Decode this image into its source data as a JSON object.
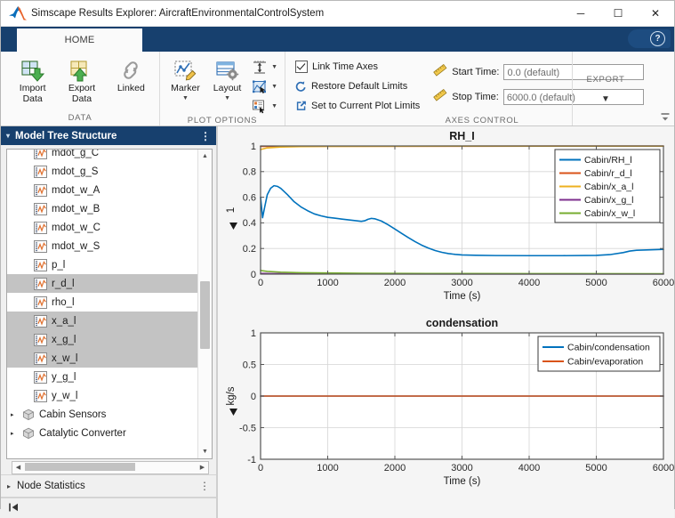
{
  "window": {
    "title": "Simscape Results Explorer: AircraftEnvironmentalControlSystem",
    "app_icon": "matlab-icon",
    "minimize": "─",
    "maximize": "☐",
    "close": "✕"
  },
  "tabs": [
    {
      "label": "HOME",
      "active": true
    }
  ],
  "help": {
    "label": "?"
  },
  "ribbon": {
    "groups": [
      {
        "name": "DATA",
        "label": "DATA",
        "buttons": [
          {
            "label_line1": "Import",
            "label_line2": "Data",
            "icon": "import-data-icon"
          },
          {
            "label_line1": "Export",
            "label_line2": "Data",
            "icon": "export-data-icon"
          },
          {
            "label_line1": "Linked",
            "label_line2": "",
            "icon": "link-icon"
          }
        ]
      },
      {
        "name": "PLOT OPTIONS",
        "label": "PLOT OPTIONS",
        "buttons": [
          {
            "label_line1": "Marker",
            "label_line2": "",
            "icon": "marker-icon",
            "caret": "▼"
          },
          {
            "label_line1": "Layout",
            "label_line2": "",
            "icon": "layout-icon",
            "caret": "▼"
          }
        ],
        "mini": [
          {
            "icon": "axes-limits-icon",
            "caret": "▼"
          },
          {
            "icon": "zoom-region-icon",
            "caret": "▼"
          },
          {
            "icon": "legend-icon",
            "caret": "▼"
          }
        ]
      },
      {
        "name": "AXES CONTROL",
        "label": "AXES CONTROL",
        "checks": [
          {
            "label": "Link Time Axes",
            "checked": true,
            "icon": "checkbox-icon"
          },
          {
            "label": "Restore Default Limits",
            "checked": false,
            "icon": "restore-icon"
          },
          {
            "label": "Set to Current Plot Limits",
            "checked": false,
            "icon": "set-limits-icon"
          }
        ],
        "times": [
          {
            "label": "Start Time:",
            "value": "0.0 (default)",
            "icon": "ruler-icon"
          },
          {
            "label": "Stop Time:",
            "value": "6000.0 (default)",
            "icon": "ruler-icon"
          }
        ]
      },
      {
        "name": "EXPORT",
        "label": "EXPORT",
        "caret": "▼"
      }
    ],
    "collapse_icon": "collapse-ribbon-icon"
  },
  "left_panel": {
    "tree_header": {
      "title": "Model Tree Structure",
      "twisty": "▾",
      "menu": "⋮"
    },
    "stats_header": {
      "title": "Node Statistics",
      "twisty": "▸",
      "menu": "⋮"
    },
    "tree_items": [
      {
        "label": "mdot_g_C",
        "icon": "signal-icon",
        "selected": false,
        "type": "signal",
        "clipped": true
      },
      {
        "label": "mdot_g_S",
        "icon": "signal-icon",
        "selected": false,
        "type": "signal"
      },
      {
        "label": "mdot_w_A",
        "icon": "signal-icon",
        "selected": false,
        "type": "signal"
      },
      {
        "label": "mdot_w_B",
        "icon": "signal-icon",
        "selected": false,
        "type": "signal"
      },
      {
        "label": "mdot_w_C",
        "icon": "signal-icon",
        "selected": false,
        "type": "signal"
      },
      {
        "label": "mdot_w_S",
        "icon": "signal-icon",
        "selected": false,
        "type": "signal"
      },
      {
        "label": "p_l",
        "icon": "signal-icon",
        "selected": false,
        "type": "signal"
      },
      {
        "label": "r_d_l",
        "icon": "signal-icon",
        "selected": true,
        "type": "signal"
      },
      {
        "label": "rho_l",
        "icon": "signal-icon",
        "selected": false,
        "type": "signal"
      },
      {
        "label": "x_a_l",
        "icon": "signal-icon",
        "selected": true,
        "type": "signal"
      },
      {
        "label": "x_g_l",
        "icon": "signal-icon",
        "selected": true,
        "type": "signal"
      },
      {
        "label": "x_w_l",
        "icon": "signal-icon",
        "selected": true,
        "type": "signal"
      },
      {
        "label": "y_g_l",
        "icon": "signal-icon",
        "selected": false,
        "type": "signal"
      },
      {
        "label": "y_w_l",
        "icon": "signal-icon",
        "selected": false,
        "type": "signal"
      },
      {
        "label": "Cabin Sensors",
        "icon": "block-cube-icon",
        "selected": false,
        "type": "node",
        "arrow": "▸"
      },
      {
        "label": "Catalytic Converter",
        "icon": "block-cube-icon",
        "selected": false,
        "type": "node",
        "arrow": "▸",
        "clipped": true
      }
    ],
    "scroll": {
      "up": "▲",
      "down": "▼",
      "left": "◀",
      "right": "▶"
    },
    "status_icon": "collapse-panel-icon"
  },
  "plot_panel": {
    "maximize_icon": "maximize-plots-icon"
  },
  "colors": {
    "blue": "#0072BD",
    "orange": "#D95319",
    "yellow": "#EDB120",
    "purple": "#7E2F8E",
    "green": "#77AC30",
    "ribbon_blue": "#17406E",
    "selection_gray": "#C3C3C3"
  },
  "chart_data": [
    {
      "type": "line",
      "title": "RH_I",
      "xlabel": "Time (s)",
      "ylabel": "1",
      "ylabel_dropdown": "▼",
      "xlim": [
        0,
        6000
      ],
      "ylim": [
        0,
        1
      ],
      "xticks": [
        0,
        1000,
        2000,
        3000,
        4000,
        5000,
        6000
      ],
      "xticklabels": [
        "0",
        "1000",
        "2000",
        "3000",
        "4000",
        "5000",
        "6000"
      ],
      "yticks": [
        0,
        0.2,
        0.4,
        0.6,
        0.8,
        1
      ],
      "yticklabels": [
        "0",
        "0.2",
        "0.4",
        "0.6",
        "0.8",
        "1"
      ],
      "grid": true,
      "legend_position": "upper-right",
      "series": [
        {
          "name": "Cabin/RH_l",
          "color": "#0072BD",
          "x": [
            0,
            30,
            60,
            100,
            150,
            200,
            250,
            300,
            400,
            500,
            600,
            700,
            800,
            900,
            1000,
            1100,
            1200,
            1300,
            1400,
            1500,
            1550,
            1600,
            1650,
            1700,
            1800,
            1900,
            2000,
            2100,
            2200,
            2300,
            2400,
            2500,
            2600,
            2700,
            2800,
            2900,
            3000,
            3200,
            3500,
            4000,
            4500,
            5000,
            5200,
            5400,
            5500,
            5600,
            5800,
            6000
          ],
          "y": [
            0.6,
            0.44,
            0.52,
            0.62,
            0.67,
            0.69,
            0.685,
            0.67,
            0.62,
            0.565,
            0.525,
            0.495,
            0.47,
            0.455,
            0.443,
            0.437,
            0.43,
            0.424,
            0.418,
            0.412,
            0.416,
            0.428,
            0.435,
            0.432,
            0.414,
            0.385,
            0.352,
            0.318,
            0.285,
            0.254,
            0.226,
            0.203,
            0.184,
            0.17,
            0.16,
            0.154,
            0.15,
            0.147,
            0.145,
            0.144,
            0.144,
            0.146,
            0.152,
            0.168,
            0.18,
            0.186,
            0.19,
            0.193
          ]
        },
        {
          "name": "Cabin/r_d_l",
          "color": "#D95319",
          "x": [
            0,
            6000
          ],
          "y": [
            0.997,
            0.999
          ]
        },
        {
          "name": "Cabin/x_a_l",
          "color": "#EDB120",
          "x": [
            0,
            100,
            300,
            600,
            1000,
            2000,
            4000,
            6000
          ],
          "y": [
            0.972,
            0.985,
            0.992,
            0.995,
            0.997,
            0.998,
            0.999,
            0.999
          ]
        },
        {
          "name": "Cabin/x_g_l",
          "color": "#7E2F8E",
          "x": [
            0,
            200,
            600,
            1500,
            3000,
            6000
          ],
          "y": [
            0.006,
            0.004,
            0.003,
            0.002,
            0.001,
            0.001
          ]
        },
        {
          "name": "Cabin/x_w_l",
          "color": "#77AC30",
          "x": [
            0,
            100,
            300,
            600,
            1000,
            1500,
            2500,
            4000,
            6000
          ],
          "y": [
            0.028,
            0.021,
            0.015,
            0.011,
            0.009,
            0.007,
            0.005,
            0.004,
            0.003
          ]
        }
      ]
    },
    {
      "type": "line",
      "title": "condensation",
      "xlabel": "Time (s)",
      "ylabel": "kg/s",
      "ylabel_dropdown": "▼",
      "xlim": [
        0,
        6000
      ],
      "ylim": [
        -1,
        1
      ],
      "xticks": [
        0,
        1000,
        2000,
        3000,
        4000,
        5000,
        6000
      ],
      "xticklabels": [
        "0",
        "1000",
        "2000",
        "3000",
        "4000",
        "5000",
        "6000"
      ],
      "yticks": [
        -1,
        -0.5,
        0,
        0.5,
        1
      ],
      "yticklabels": [
        "-1",
        "-0.5",
        "0",
        "0.5",
        "1"
      ],
      "grid": true,
      "legend_position": "upper-right",
      "series": [
        {
          "name": "Cabin/condensation",
          "color": "#0072BD",
          "x": [
            0,
            6000
          ],
          "y": [
            0,
            0
          ]
        },
        {
          "name": "Cabin/evaporation",
          "color": "#D95319",
          "x": [
            0,
            6000
          ],
          "y": [
            0,
            0
          ]
        }
      ]
    }
  ]
}
